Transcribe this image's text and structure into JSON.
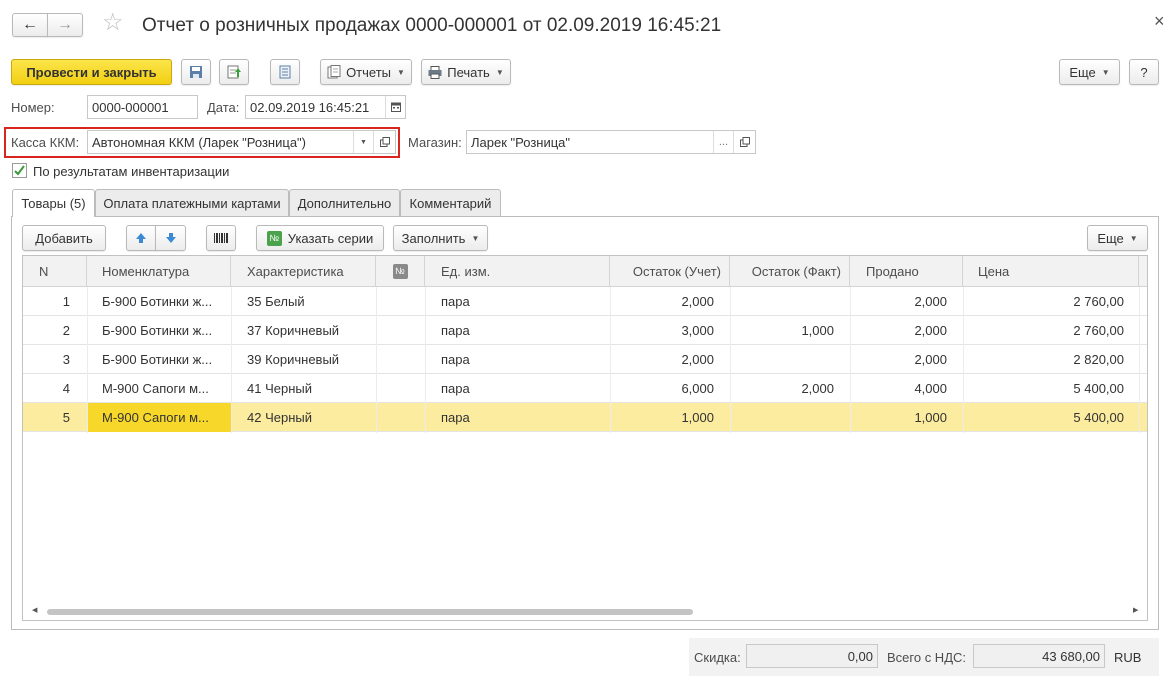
{
  "window": {
    "title": "Отчет о розничных продажах 0000-000001 от 02.09.2019 16:45:21",
    "close_glyph": "×"
  },
  "toolbar": {
    "post_close_label": "Провести и закрыть",
    "reports_label": "Отчеты",
    "print_label": "Печать",
    "more_label": "Еще",
    "help_label": "?"
  },
  "form": {
    "number_label": "Номер:",
    "number_value": "0000-000001",
    "date_label": "Дата:",
    "date_value": "02.09.2019 16:45:21",
    "kkm_label": "Касса ККМ:",
    "kkm_value": "Автономная ККМ (Ларек \"Розница\")",
    "store_label": "Магазин:",
    "store_value": "Ларек \"Розница\"",
    "store_select": "...",
    "inventory_label": "По результатам инвентаризации",
    "inventory_checked": true
  },
  "tabs": [
    {
      "label": "Товары (5)",
      "active": true
    },
    {
      "label": "Оплата платежными картами",
      "active": false
    },
    {
      "label": "Дополнительно",
      "active": false
    },
    {
      "label": "Комментарий",
      "active": false
    }
  ],
  "table_toolbar": {
    "add_label": "Добавить",
    "series_label": "Указать серии",
    "fill_label": "Заполнить",
    "more_label": "Еще"
  },
  "table": {
    "columns": [
      "N",
      "Номенклатура",
      "Характеристика",
      "№",
      "Ед. изм.",
      "Остаток (Учет)",
      "Остаток (Факт)",
      "Продано",
      "Цена"
    ],
    "rows": [
      {
        "n": "1",
        "item": "Б-900 Ботинки ж...",
        "char": "35 Белый",
        "unit": "пара",
        "stock_acc": "2,000",
        "stock_fact": "",
        "sold": "2,000",
        "price": "2 760,00"
      },
      {
        "n": "2",
        "item": "Б-900 Ботинки ж...",
        "char": "37 Коричневый",
        "unit": "пара",
        "stock_acc": "3,000",
        "stock_fact": "1,000",
        "sold": "2,000",
        "price": "2 760,00"
      },
      {
        "n": "3",
        "item": "Б-900 Ботинки ж...",
        "char": "39 Коричневый",
        "unit": "пара",
        "stock_acc": "2,000",
        "stock_fact": "",
        "sold": "2,000",
        "price": "2 820,00"
      },
      {
        "n": "4",
        "item": "М-900 Сапоги м...",
        "char": "41 Черный",
        "unit": "пара",
        "stock_acc": "6,000",
        "stock_fact": "2,000",
        "sold": "4,000",
        "price": "5 400,00"
      },
      {
        "n": "5",
        "item": "М-900 Сапоги м...",
        "char": "42 Черный",
        "unit": "пара",
        "stock_acc": "1,000",
        "stock_fact": "",
        "sold": "1,000",
        "price": "5 400,00"
      }
    ],
    "selected_row": 5
  },
  "footer": {
    "discount_label": "Скидка:",
    "discount_value": "0,00",
    "total_label": "Всего с НДС:",
    "total_value": "43 680,00",
    "currency": "RUB"
  },
  "colors": {
    "primary_button": "#f5d317",
    "selected_row": "#fbeca0",
    "selected_cell": "#f7d82a",
    "highlight_border": "#d9251d"
  },
  "icons": [
    "back-arrow-icon",
    "forward-arrow-icon",
    "star-icon",
    "save-icon",
    "post-icon",
    "structure-icon",
    "reports-icon",
    "print-icon",
    "calendar-icon",
    "open-icon",
    "checkbox-icon",
    "move-up-icon",
    "move-down-icon",
    "barcode-icon",
    "series-icon",
    "scroll-left-icon",
    "scroll-right-icon"
  ]
}
